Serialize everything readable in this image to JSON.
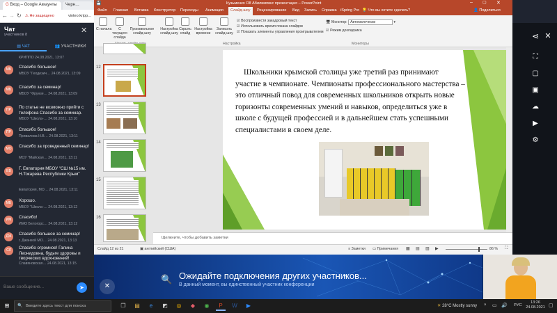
{
  "browser": {
    "tab1": "Вход – Google Аккаунты",
    "tab2": "Черн…",
    "insecure": "Не защищено",
    "url": "vinteo.kripp…"
  },
  "chat": {
    "title": "Чат",
    "participants": "участников 8",
    "tab_chat": "ЧАТ",
    "tab_users": "УЧАСТНИКИ",
    "input_placeholder": "Ваше сообщение...",
    "messages": [
      {
        "initials": "КР",
        "text": "",
        "sender": "КРИППО     24.08.2021, 13:07"
      },
      {
        "initials": "МБ",
        "text": "Спасибо большое!",
        "sender": "МБОУ \"Геодезич…   24.08.2021, 13:09"
      },
      {
        "initials": "МБ",
        "text": "Спасибо за семинар!",
        "sender": "МБОУ \"Фрунзе…   24.08.2021, 13:09"
      },
      {
        "initials": "ПР",
        "text": "По статье не возможно прийти с телефона Спасибо за семинар.",
        "sender": "МБОУ \"Школа-…   24.08.2021, 13:10"
      },
      {
        "initials": "ПР",
        "text": "Спасибо большое!",
        "sender": "Привалова Н.В…   24.08.2021, 13:11"
      },
      {
        "initials": "МО",
        "text": "Спасибо за проведенный семинар!",
        "sender": "МОУ \"Майская…   24.08.2021, 13:11"
      },
      {
        "initials": "ЕВ",
        "text": "Г. Евпатория МБОУ \"СШ №15 им. Н.Токарева Республики Крым\"",
        "sender": "Евпатория, МО…   24.08.2021, 13:11"
      },
      {
        "initials": "МБ",
        "text": "Хорошо.",
        "sender": "МБОУ \"Школа-…   24.08.2021, 13:12"
      },
      {
        "initials": "ИМ",
        "text": "Спасибо!",
        "sender": "ИМО Белогорс…   24.08.2021, 13:12"
      },
      {
        "initials": "ДЖ",
        "text": "Спасибо большое за семинар!",
        "sender": "г. Джанкой МО…   24.08.2021, 13:13"
      },
      {
        "initials": "СЛ",
        "text": "Спасибо огромное! Галина Леонидовна, будьте здоровы и творческих вдохновений!",
        "sender": "Славяновская…   24.08.2021, 13:15"
      }
    ]
  },
  "ppt": {
    "title": "Кузьменко О8 Абилимпикс презентация – PowerPoint",
    "user": "Пользователь",
    "tabs": [
      "Файл",
      "Главная",
      "Вставка",
      "Конструктор",
      "Переходы",
      "Анимация",
      "Слайд-шоу",
      "Рецензирование",
      "Вид",
      "Запись",
      "Справка",
      "iSpring Pro"
    ],
    "active_tab": "Слайд-шоу",
    "search": "Что вы хотите сделать?",
    "share": "Поделиться",
    "ribbon": {
      "from_start": "С начала",
      "from_current": "С текущего слайда",
      "custom": "Произвольное слайд-шоу",
      "setup": "Настройка слайд-шоу",
      "hide": "Скрыть слайд",
      "timing": "Настройка времени",
      "record": "Записать слайд-шоу",
      "chk1": "Воспроизвести закадровый текст",
      "chk2": "Использовать время показа слайдов",
      "chk3": "Показать элементы управления проигрывателем",
      "monitor_label": "Монитор:",
      "monitor_value": "Автоматически",
      "presenter": "Режим докладчика",
      "grp_start": "Начать слайд-шоу",
      "grp_setup": "Настройка",
      "grp_monitors": "Мониторы"
    },
    "thumb_numbers": [
      "12",
      "13",
      "14",
      "15",
      "16"
    ],
    "slide_text": "Школьники крымской столицы уже третий раз принимают участие в чемпионате. Чемпионаты профессионального мастерства – это отличный повод для современных школьников открыть новые горизонты современных умений и навыков, определиться уже в школе с будущей профессией и в дальнейшем стать успешными специалистами в своем деле.",
    "notes": "Щелкните, чтобы добавить заметки",
    "status_slide": "Слайд 12 из 21",
    "status_lang": "английский (США)",
    "status_notes": "Заметки",
    "status_comments": "Примечания",
    "zoom": "86 %"
  },
  "banner": {
    "title": "Ожидайте подключения других участников...",
    "subtitle": "В данный момент, вы единственный участник конференции"
  },
  "taskbar": {
    "search": "Введите здесь текст для поиска",
    "weather": "28°C  Mostly sunny",
    "lang": "РУС",
    "time": "13:26",
    "date": "24.08.2021"
  }
}
